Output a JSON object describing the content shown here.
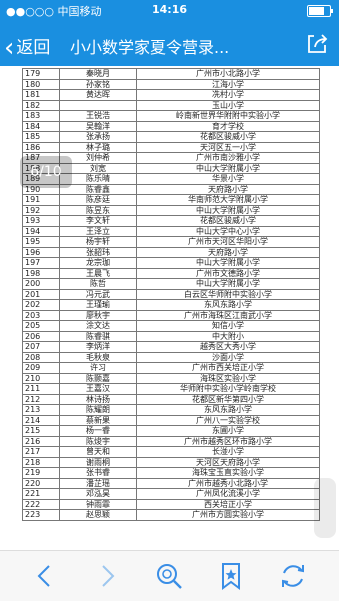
{
  "status": {
    "carrier": "●●○○○ 中国移动",
    "time": "14:16"
  },
  "nav": {
    "back_label": "返回",
    "title": "小小数学家夏令营录..."
  },
  "pager": {
    "label": "6/10"
  },
  "table": {
    "rows": [
      [
        "179",
        "秦晓月",
        "广州市小北路小学"
      ],
      [
        "180",
        "孙家铭",
        "江海小学"
      ],
      [
        "181",
        "黄达晖",
        "冼村小学"
      ],
      [
        "182",
        "",
        "玉山小学"
      ],
      [
        "183",
        "王锐浩",
        "岭南新世界华附附中实验小学"
      ],
      [
        "184",
        "吴翰洋",
        "育才学校"
      ],
      [
        "185",
        "张承扬",
        "花都区骏威小学"
      ],
      [
        "186",
        "林子璐",
        "天河区五一小学"
      ],
      [
        "187",
        "刘仲希",
        "广州市南沙雅小学"
      ],
      [
        "188",
        "刘宽",
        "中山大学附属小学"
      ],
      [
        "189",
        "陈乐晴",
        "华景小学"
      ],
      [
        "190",
        "陈睿鑫",
        "天府路小学"
      ],
      [
        "191",
        "陈彦廷",
        "华南师范大学附属小学"
      ],
      [
        "192",
        "陈昱东",
        "中山大学附属小学"
      ],
      [
        "193",
        "李文轩",
        "花都区骏威小学"
      ],
      [
        "194",
        "王泽立",
        "中山大学中心小学"
      ],
      [
        "195",
        "杨宇轩",
        "广州市天河区华阳小学"
      ],
      [
        "196",
        "张韶玮",
        "天府路小学"
      ],
      [
        "197",
        "龙宗珈",
        "中山大学附属小学"
      ],
      [
        "198",
        "王晨飞",
        "广州市文德路小学"
      ],
      [
        "200",
        "陈哲",
        "中山大学附属小学"
      ],
      [
        "201",
        "冯元武",
        "白云区华师附中实验小学"
      ],
      [
        "202",
        "王瑾瑜",
        "东风东路小学"
      ],
      [
        "203",
        "廖秋宇",
        "广州市海珠区江南武小学"
      ],
      [
        "205",
        "涂文达",
        "知信小学"
      ],
      [
        "206",
        "陈睿骐",
        "中大附小"
      ],
      [
        "207",
        "李炳洋",
        "越秀区大秀小学"
      ],
      [
        "208",
        "毛秋泉",
        "沙面小学"
      ],
      [
        "209",
        "许习",
        "广州市西关培正小学"
      ],
      [
        "210",
        "陈颢嘉",
        "海珠区实验小学"
      ],
      [
        "211",
        "王嘉汉",
        "华师附中实验小学岭南学校"
      ],
      [
        "212",
        "林诗扬",
        "花都区新华第四小学"
      ],
      [
        "213",
        "陈耀朗",
        "东风东路小学"
      ],
      [
        "214",
        "蔡新果",
        "广州八一实验学校"
      ],
      [
        "215",
        "杨一睿",
        "东圃小学"
      ],
      [
        "216",
        "陈焌宇",
        "广州市越秀区环市路小学"
      ],
      [
        "217",
        "曾天和",
        "长湴小学"
      ],
      [
        "218",
        "谢雨桐",
        "天河区天府路小学"
      ],
      [
        "219",
        "张书睿",
        "海珠宝玉直实验小学"
      ],
      [
        "220",
        "潘芷瑶",
        "广州市越秀小北路小学"
      ],
      [
        "221",
        "邓泓昊",
        "广州凤化流溪小学"
      ],
      [
        "222",
        "钟雨霏",
        "西关培正小学"
      ],
      [
        "223",
        "赵思颖",
        "广州市方圆实验小学"
      ]
    ]
  },
  "icons": {
    "back": "chevron-left-icon",
    "share": "share-icon",
    "prev": "arrow-left-icon",
    "next": "arrow-right-icon",
    "find": "search-icon",
    "bookmark": "bookmark-icon",
    "refresh": "refresh-icon"
  },
  "colors": {
    "accent": "#1a8fe0",
    "toolbar_icon": "#3a8ee6"
  },
  "battery": {
    "level": 0.85
  }
}
